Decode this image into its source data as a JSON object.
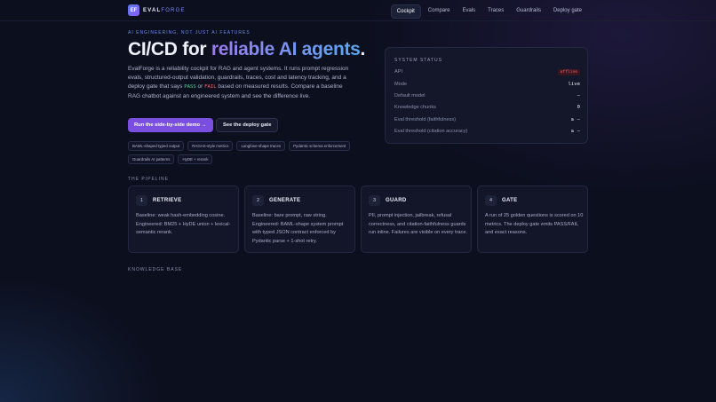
{
  "brand": {
    "badge": "EF",
    "name_a": "EVAL",
    "name_b": "FORGE"
  },
  "nav": [
    "Cockpit",
    "Compare",
    "Evals",
    "Traces",
    "Guardrails",
    "Deploy gate"
  ],
  "hero": {
    "eyebrow": "AI ENGINEERING, NOT JUST AI FEATURES",
    "title_a": "CI/CD for ",
    "title_b": "reliable AI agents",
    "title_c": ".",
    "desc_a": "EvalForge is a reliability cockpit for RAG and agent systems. It runs prompt regression evals, structured-output validation, guardrails, traces, cost and latency tracking, and a deploy gate that says ",
    "pass": "PASS",
    "or": " or ",
    "fail": "FAIL",
    "desc_b": " based on measured results. Compare a baseline RAG chatbot against an engineered system and see the difference live.",
    "primary_cta": "Run the side-by-side demo →",
    "secondary_cta": "See the deploy gate",
    "chips": [
      "BAML-shaped typed output",
      "RAGAS-style metrics",
      "Langfuse-shape traces",
      "Pydantic schema enforcement",
      "Guardrails AI patterns",
      "HyDE + rerank"
    ]
  },
  "status": {
    "title": "SYSTEM STATUS",
    "rows": [
      {
        "label": "API",
        "value": "offline"
      },
      {
        "label": "Mode",
        "value": "live"
      },
      {
        "label": "Default model",
        "value": "—"
      },
      {
        "label": "Knowledge chunks",
        "value": "0"
      },
      {
        "label": "Eval threshold (faithfulness)",
        "value": "≥ —"
      },
      {
        "label": "Eval threshold (citation accuracy)",
        "value": "≥ —"
      }
    ]
  },
  "pipeline": {
    "label": "THE PIPELINE",
    "cards": [
      {
        "num": "1",
        "title": "RETRIEVE",
        "body": "Baseline: weak hash-embedding cosine. Engineered: BM25 + HyDE union + lexical-semantic rerank."
      },
      {
        "num": "2",
        "title": "GENERATE",
        "body": "Baseline: bare prompt, raw string. Engineered: BAML-shape system prompt with typed JSON contract enforced by Pydantic parse + 1-shot retry."
      },
      {
        "num": "3",
        "title": "GUARD",
        "body": "PII, prompt injection, jailbreak, refusal correctness, and citation-faithfulness guards run inline. Failures are visible on every trace."
      },
      {
        "num": "4",
        "title": "GATE",
        "body": "A run of 25 golden questions is scored on 10 metrics. The deploy gate emits PASS/FAIL and exact reasons."
      }
    ]
  },
  "knowledge": {
    "label": "KNOWLEDGE BASE"
  }
}
